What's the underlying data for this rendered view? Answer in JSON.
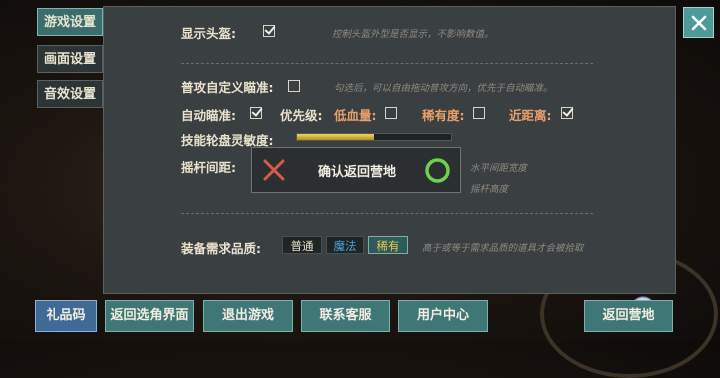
{
  "side_tabs": [
    {
      "label": "游戏设置",
      "active": true
    },
    {
      "label": "画面设置",
      "active": false
    },
    {
      "label": "音效设置",
      "active": false
    }
  ],
  "settings": {
    "show_helmet": {
      "label": "显示头盔:",
      "checked": true,
      "hint": "控制头盔外型是否显示，不影响数值。"
    },
    "custom_aim": {
      "label": "普攻自定义瞄准:",
      "checked": false,
      "hint": "勾选后，可以自由拖动普攻方向，优先于自动瞄准。"
    },
    "auto_aim": {
      "label": "自动瞄准:",
      "checked": true
    },
    "priority": {
      "label": "优先级:",
      "low_hp": {
        "label": "低血量:",
        "checked": false
      },
      "rarity": {
        "label": "稀有度:",
        "checked": false
      },
      "nearest": {
        "label": "近距离:",
        "checked": true
      }
    },
    "skill_sensitivity": {
      "label": "技能轮盘灵敏度:",
      "value_percent": 50
    },
    "joystick_spacing": {
      "label": "摇杆间距:",
      "hint_h": "水平间距宽度",
      "hint_v": "摇杆高度"
    },
    "equip_quality": {
      "label": "装备需求品质:",
      "options": [
        "普通",
        "魔法",
        "稀有"
      ],
      "selected": "稀有",
      "hint": "高于或等于需求品质的道具才会被拾取"
    }
  },
  "modal": {
    "text": "确认返回营地"
  },
  "bottom_buttons": [
    "礼品码",
    "返回选角界面",
    "退出游戏",
    "联系客服",
    "用户中心",
    "返回营地"
  ],
  "colors": {
    "accent_teal": "#3f7777",
    "magic_blue": "#4aa3e0",
    "rare_gold": "#e8c84a",
    "confirm_green": "#6ed04c",
    "cancel_red": "#d85a4a"
  }
}
